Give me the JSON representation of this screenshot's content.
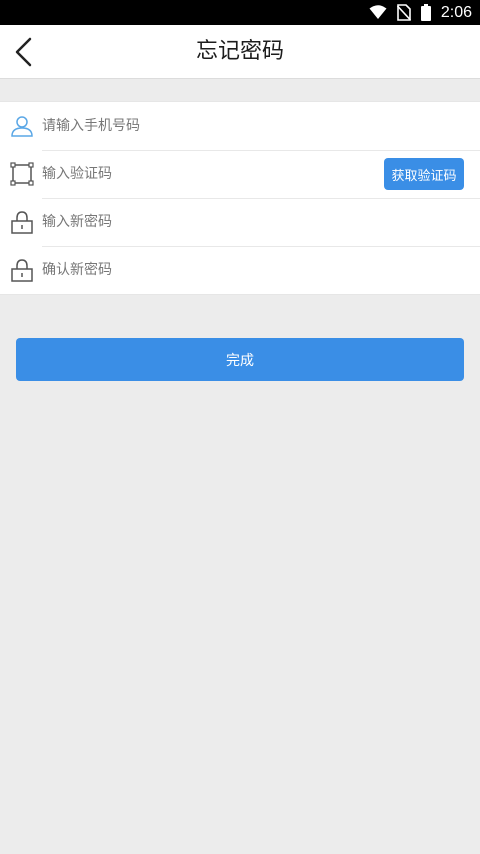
{
  "status_bar": {
    "time": "2:06",
    "icons": [
      "wifi-icon",
      "no-sim-icon",
      "battery-icon"
    ]
  },
  "header": {
    "title": "忘记密码",
    "back_icon": "chevron-left-icon"
  },
  "form": {
    "phone": {
      "placeholder": "请输入手机号码",
      "value": "",
      "icon": "user-icon"
    },
    "code": {
      "placeholder": "输入验证码",
      "value": "",
      "icon": "scan-frame-icon",
      "button_label": "获取验证码"
    },
    "new_password": {
      "placeholder": "输入新密码",
      "value": "",
      "icon": "lock-icon"
    },
    "confirm_password": {
      "placeholder": "确认新密码",
      "value": "",
      "icon": "lock-icon"
    }
  },
  "submit": {
    "label": "完成"
  },
  "colors": {
    "accent": "#3a8ee6",
    "background": "#ececec",
    "user_icon": "#5aa7e6"
  }
}
